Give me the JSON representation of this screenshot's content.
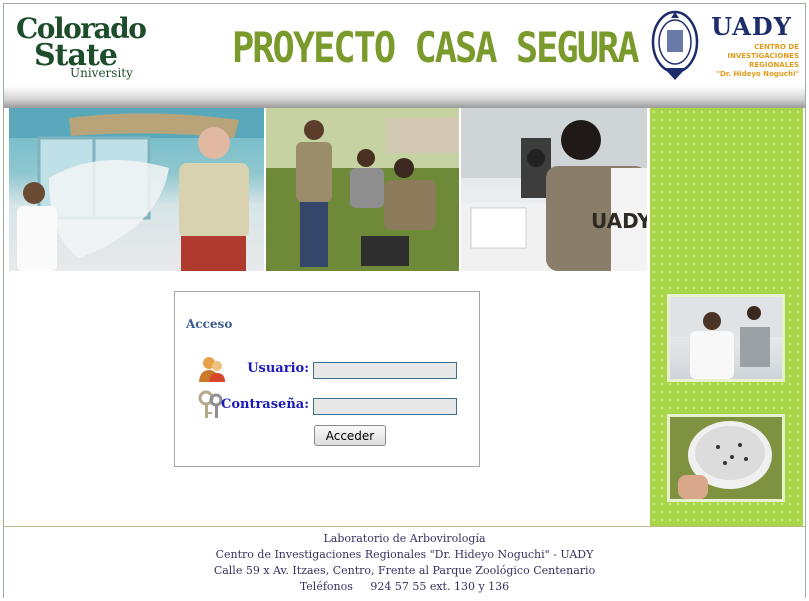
{
  "header": {
    "title": "PROYECTO CASA SEGURA",
    "csu_logo": {
      "line1": "Colorado",
      "line2": "State",
      "line3": "University"
    },
    "uady_logo": {
      "name": "UADY",
      "line1": "CENTRO DE",
      "line2": "INVESTIGACIONES",
      "line3": "REGIONALES",
      "line4": "\"Dr. Hideyo Noguchi\""
    },
    "seal_icon": "university-seal-icon"
  },
  "login": {
    "heading": "Acceso",
    "username_label": "Usuario:",
    "password_label": "Contraseña:",
    "username_value": "",
    "password_value": "",
    "submit_label": "Acceder",
    "user_icon": "users-icon",
    "key_icon": "keys-icon"
  },
  "footer": {
    "line1": "Laboratorio de Arbovirología",
    "line2": "Centro de Investigaciones Regionales \"Dr. Hideyo Noguchi\" - UADY",
    "line3": "Calle 59 x Av. Itzaes, Centro, Frente al Parque Zoológico Centenario",
    "line4": "Teléfonos     924 57 55 ext. 130 y 136"
  },
  "colors": {
    "title": "#7a9b2b",
    "csu_green": "#1e4d2b",
    "uady_blue": "#1d2c6b",
    "uady_orange": "#e39a1a",
    "sidebar_green": "#a9d648",
    "label_blue": "#1a1ab8"
  }
}
